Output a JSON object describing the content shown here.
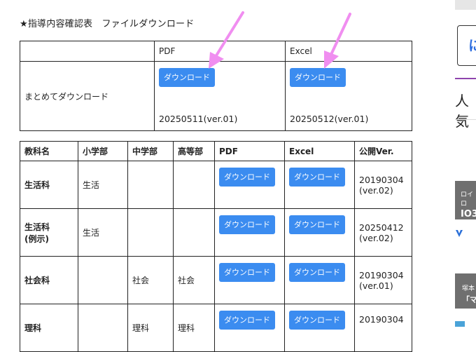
{
  "heading": "★指導内容確認表　ファイルダウンロード",
  "summary_table": {
    "headers": [
      "",
      "PDF",
      "Excel"
    ],
    "row_label": "まとめてダウンロード",
    "pdf": {
      "button": "ダウンロード",
      "version": "20250511(ver.01)"
    },
    "excel": {
      "button": "ダウンロード",
      "version": "20250512(ver.01)"
    }
  },
  "subject_table": {
    "headers": [
      "教科名",
      "小学部",
      "中学部",
      "高等部",
      "PDF",
      "Excel",
      "公開Ver."
    ],
    "rows": [
      {
        "subject": "生活科",
        "elementary": "生活",
        "junior": "",
        "senior": "",
        "pdf": "ダウンロード",
        "excel": "ダウンロード",
        "ver_date": "20190304",
        "ver_no": "(ver.02)"
      },
      {
        "subject": "生活科",
        "subject2": "(例示)",
        "elementary": "生活",
        "junior": "",
        "senior": "",
        "pdf": "ダウンロード",
        "excel": "ダウンロード",
        "ver_date": "20250412",
        "ver_no": "(ver.02)"
      },
      {
        "subject": "社会科",
        "elementary": "",
        "junior": "社会",
        "senior": "社会",
        "pdf": "ダウンロード",
        "excel": "ダウンロード",
        "ver_date": "20190304",
        "ver_no": "(ver.01)"
      },
      {
        "subject": "理科",
        "elementary": "",
        "junior": "理科",
        "senior": "理科",
        "pdf": "ダウンロード",
        "excel": "ダウンロード",
        "ver_date": "20190304",
        "ver_no": ""
      }
    ]
  },
  "sidebar": {
    "ranking_title": "人気",
    "ad1_line1": "ロイロ",
    "ad1_line2": "IO3",
    "ad2_line1": "塚本",
    "ad2_line2": "「マ"
  },
  "colors": {
    "button": "#3b8cf0",
    "arrow": "#f08ef0",
    "sidebar_dark": "#6f6f6f"
  }
}
